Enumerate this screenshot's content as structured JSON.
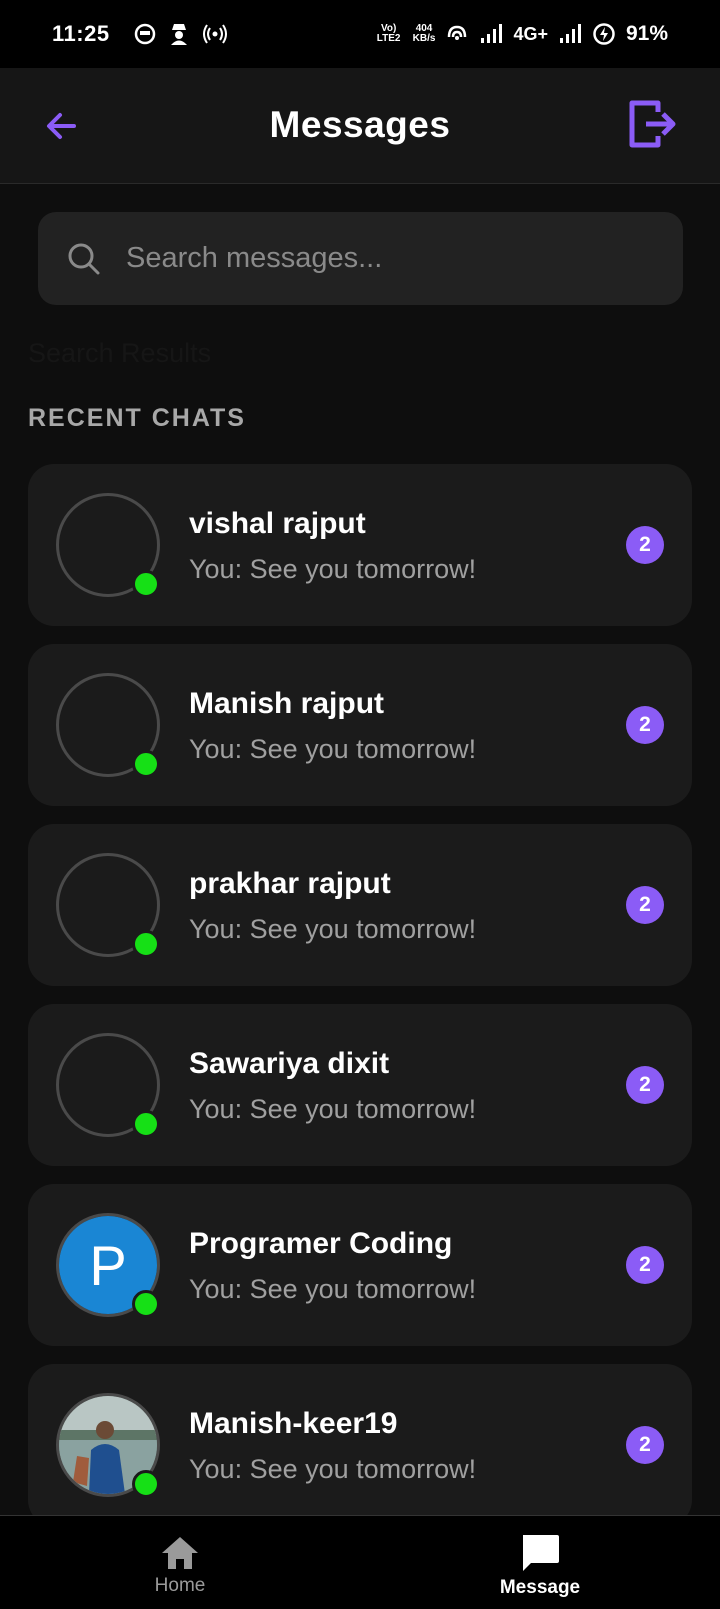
{
  "status_bar": {
    "time": "11:25",
    "left_icons": [
      "chat-bubble-icon",
      "spy-icon",
      "hotspot-icon"
    ],
    "volte": "Vo) LTE2",
    "speed_value": "404",
    "speed_unit": "KB/s",
    "network_label": "4G+",
    "battery": "91%"
  },
  "header": {
    "title": "Messages",
    "back_icon": "back-arrow-icon",
    "logout_icon": "logout-icon",
    "accent_color": "#8b5cf6"
  },
  "search": {
    "placeholder": "Search messages...",
    "value": ""
  },
  "search_results_label": "Search Results",
  "recent_title": "RECENT CHATS",
  "chats": [
    {
      "name": "vishal rajput",
      "preview": "You: See you tomorrow!",
      "unread": "2",
      "avatar": "empty"
    },
    {
      "name": "Manish rajput",
      "preview": "You: See you tomorrow!",
      "unread": "2",
      "avatar": "empty"
    },
    {
      "name": "prakhar rajput",
      "preview": "You: See you tomorrow!",
      "unread": "2",
      "avatar": "empty"
    },
    {
      "name": "Sawariya dixit",
      "preview": "You: See you tomorrow!",
      "unread": "2",
      "avatar": "empty"
    },
    {
      "name": "Programer Coding",
      "preview": "You: See you tomorrow!",
      "unread": "2",
      "avatar": "letter",
      "letter": "P"
    },
    {
      "name": "Manish-keer19",
      "preview": "You: See you tomorrow!",
      "unread": "2",
      "avatar": "photo"
    }
  ],
  "bottom_nav": {
    "items": [
      {
        "label": "Home",
        "icon": "home-icon",
        "active": false
      },
      {
        "label": "Message",
        "icon": "message-icon",
        "active": true
      }
    ]
  },
  "colors": {
    "background": "#0e0e0e",
    "card": "#1b1b1b",
    "accent": "#8b5cf6",
    "online": "#16e016"
  }
}
